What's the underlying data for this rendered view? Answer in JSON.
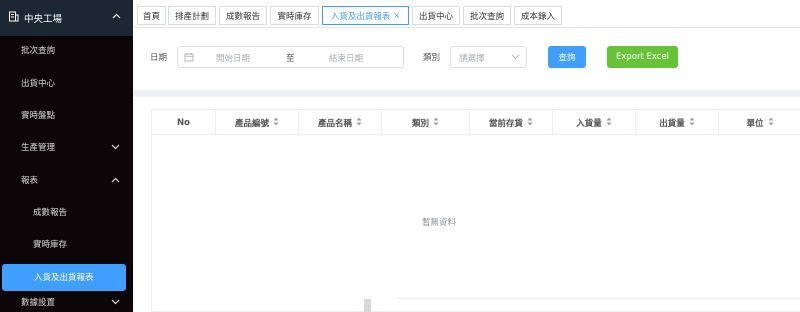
{
  "sidebar": {
    "brand": "中央工場",
    "brand_icon": "building-icon",
    "items": [
      {
        "label": "批次查詢"
      },
      {
        "label": "出貨中心"
      },
      {
        "label": "實時盤點"
      },
      {
        "label": "生產管理"
      },
      {
        "label": "報表"
      },
      {
        "label": "成數報告"
      },
      {
        "label": "實時庫存"
      },
      {
        "label": "入貨及出貨報表"
      },
      {
        "label": "數據設置"
      }
    ],
    "active_bg": "#409eff"
  },
  "tabs": [
    {
      "label": "首頁"
    },
    {
      "label": "排產計劃"
    },
    {
      "label": "成數報告"
    },
    {
      "label": "實時庫存"
    },
    {
      "label": "入貨及出貨報表",
      "close": "×"
    },
    {
      "label": "出貨中心"
    },
    {
      "label": "批次查詢"
    },
    {
      "label": "成本錄入"
    }
  ],
  "filters": {
    "date_label": "日期",
    "start_placeholder": "開始日期",
    "range_separator": "至",
    "end_placeholder": "結束日期",
    "category_label": "類別",
    "category_placeholder": "請選擇",
    "query_button": "查詢",
    "export_button": "Export Excel",
    "query_color": "#409eff",
    "export_color": "#67c23a"
  },
  "table": {
    "columns": [
      "No",
      "產品編號",
      "產品名稱",
      "類別",
      "當前存貨",
      "入貨量",
      "出貨量",
      "單位"
    ],
    "empty_text": "暫無資料"
  }
}
